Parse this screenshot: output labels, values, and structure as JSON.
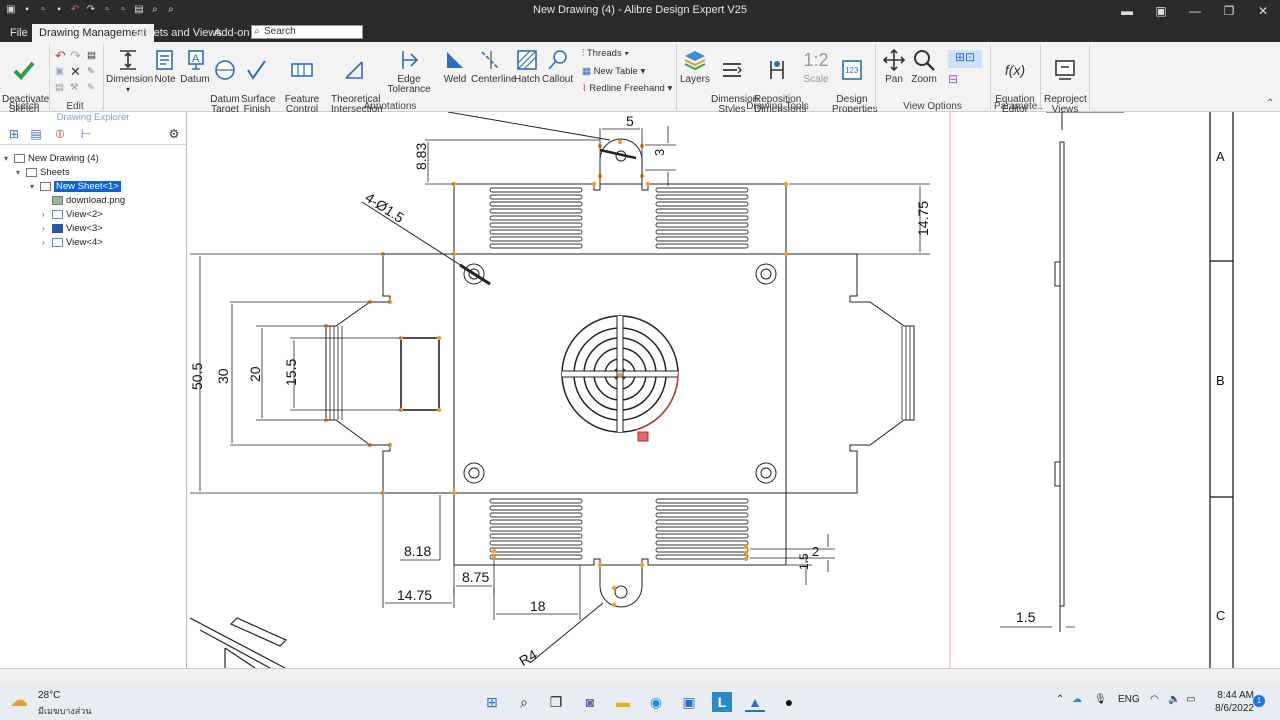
{
  "window": {
    "title": "New Drawing (4) - Alibre Design Expert V25"
  },
  "menu": {
    "file": "File",
    "tabs": [
      "Drawing Management",
      "Sheets and Views",
      "Add-on"
    ],
    "search_placeholder": "Search"
  },
  "ribbon": {
    "deactivate": "Deactivate\nSketch",
    "dimension": "Dimension",
    "note": "Note",
    "datum": "Datum",
    "datum_target": "Datum\nTarget",
    "surface_finish": "Surface\nFinish",
    "feature_control_frame": "Feature\nControl Frame",
    "theoretical_intersection": "Theoretical\nIntersection",
    "edge_tolerance": "Edge Tolerance",
    "weld": "Weld",
    "centerline": "Centerline",
    "hatch": "Hatch",
    "callout": "Callout",
    "threads": "Threads",
    "new_table": "New Table",
    "redline_freehand": "Redline Freehand",
    "layers": "Layers",
    "dimension_styles": "Dimension\nStyles",
    "reposition_dimensions": "Reposition\nDimensions",
    "scale": "Scale",
    "scale_glyph": "1:2",
    "design_properties": "Design\nProperties",
    "pan": "Pan",
    "zoom": "Zoom",
    "equation_editor": "Equation\nEditor",
    "reproject_views": "Reproject\nViews",
    "groups": {
      "sketch": "Sketch",
      "edit": "Edit",
      "annotations": "Annotations",
      "drawing_tools": "Drawing Tools",
      "view_options": "View Options",
      "parameters": "Paramete.."
    }
  },
  "explorer": {
    "title": "Drawing Explorer",
    "tree": [
      {
        "label": "New Drawing (4)",
        "selected": false
      },
      {
        "label": "Sheets",
        "selected": false
      },
      {
        "label": "New Sheet<1>",
        "selected": true
      },
      {
        "label": "download.png",
        "selected": false
      },
      {
        "label": "View<2>",
        "selected": false
      },
      {
        "label": "View<3>",
        "selected": false
      },
      {
        "label": "View<4>",
        "selected": false
      }
    ]
  },
  "drawing": {
    "dims": {
      "d5": "5",
      "d3": "3",
      "d883": "8.83",
      "hole": "4-Ø1.5",
      "d1475_right": "14.75",
      "d505": "50.5",
      "d30": "30",
      "d20": "20",
      "d155": "15.5",
      "d818": "8.18",
      "d875": "8.75",
      "d1475_bottom": "14.75",
      "d18": "18",
      "d15_small": "1.5",
      "d2": "2",
      "r4": "R4",
      "d15_side": "1.5"
    },
    "zones": [
      "A",
      "B",
      "C"
    ]
  },
  "taskbar": {
    "temp": "28°C",
    "weather": "มีเมฆบางส่วน",
    "lang": "ENG",
    "time": "8:44 AM",
    "date": "8/6/2022",
    "notif": "1"
  },
  "colors": {
    "accent": "#0a64d6",
    "dark": "#2b2b2b",
    "ribbon": "#f3f3f3",
    "vertex": "#f29a2e",
    "highlight": "#d83b3b"
  }
}
